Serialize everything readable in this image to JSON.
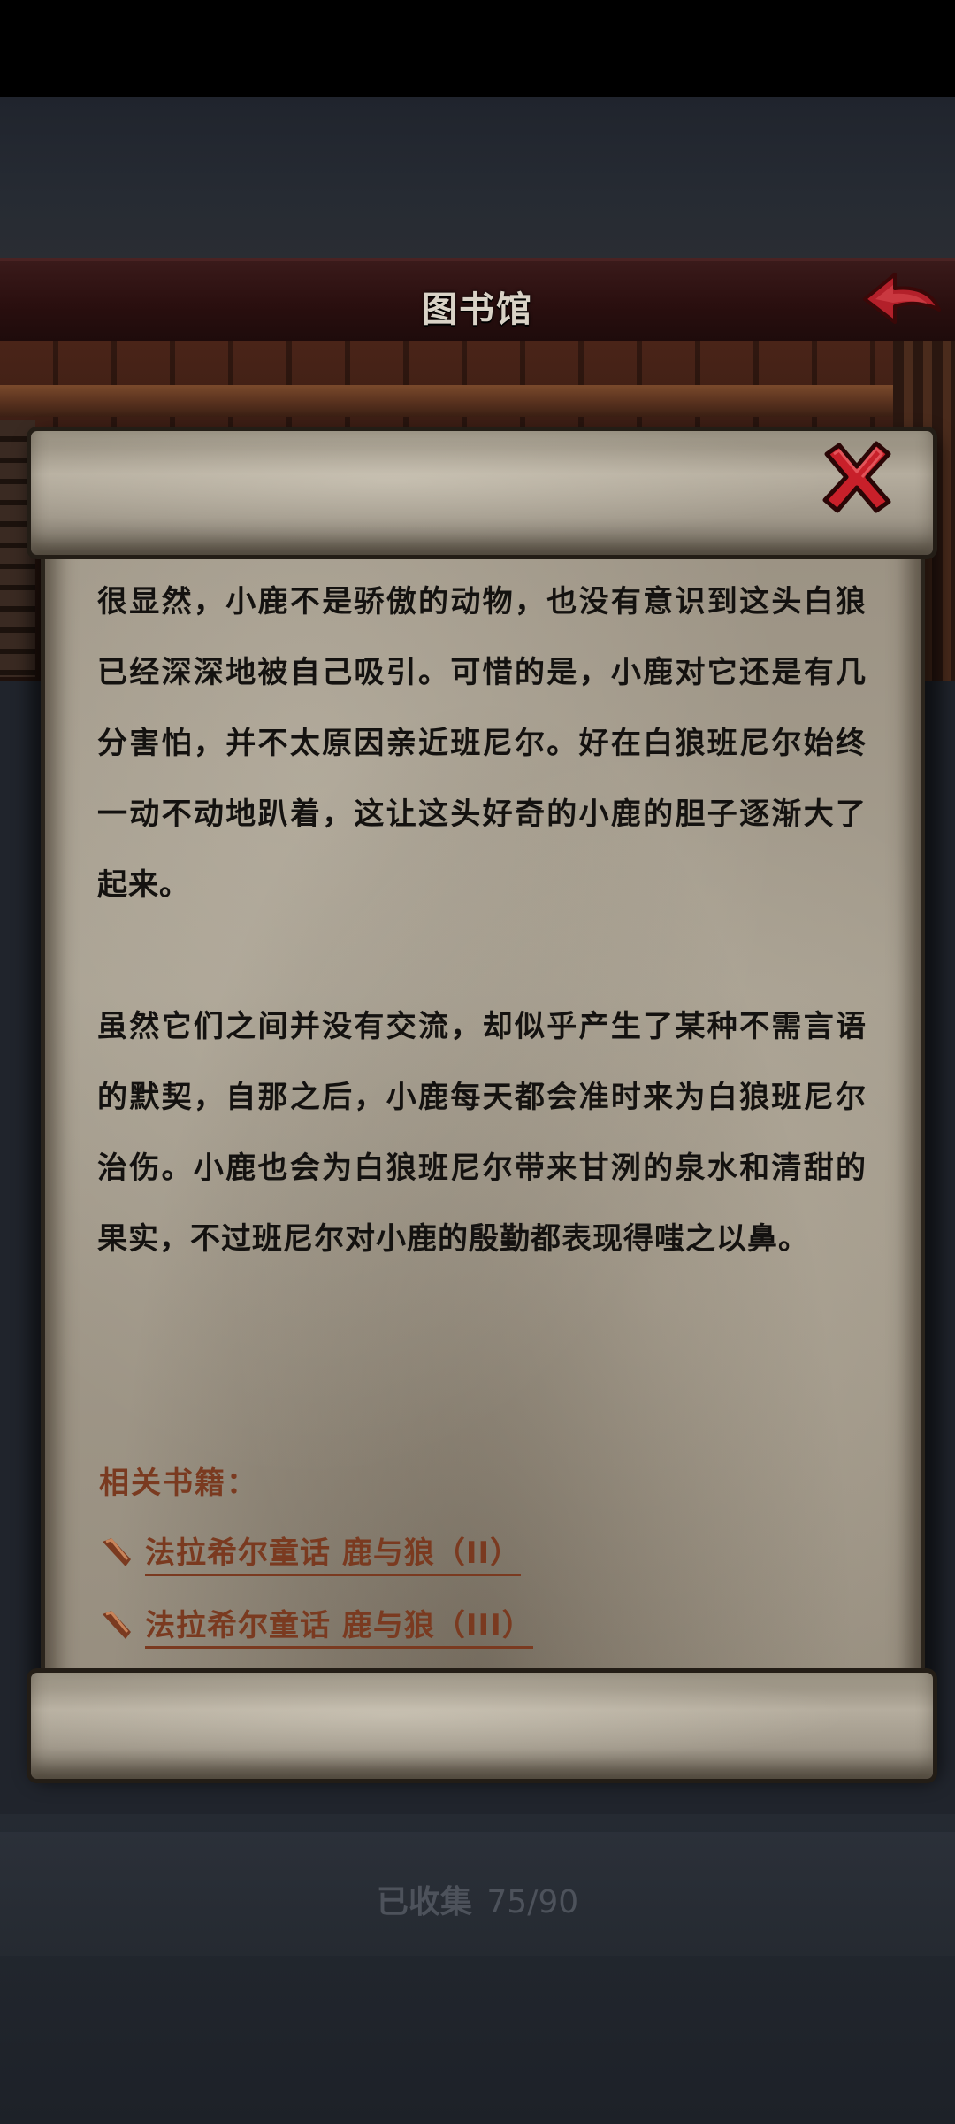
{
  "header": {
    "title": "图书馆"
  },
  "icons": {
    "back": "back-arrow-icon",
    "close": "close-x-icon",
    "link": "quill-icon"
  },
  "content": {
    "paragraphs": [
      "很显然，小鹿不是骄傲的动物，也没有意识到这头白狼已经深深地被自己吸引。可惜的是，小鹿对它还是有几分害怕，并不太原因亲近班尼尔。好在白狼班尼尔始终一动不动地趴着，这让这头好奇的小鹿的胆子逐渐大了起来。",
      "虽然它们之间并没有交流，却似乎产生了某种不需言语的默契，自那之后，小鹿每天都会准时来为白狼班尼尔治伤。小鹿也会为白狼班尼尔带来甘洌的泉水和清甜的果实，不过班尼尔对小鹿的殷勤都表现得嗤之以鼻。"
    ],
    "related_title": "相关书籍：",
    "related_books": [
      "法拉希尔童话 鹿与狼（II）",
      "法拉希尔童话 鹿与狼（III）"
    ]
  },
  "footer": {
    "collected_label": "已收集",
    "collected_count": "75/90"
  },
  "colors": {
    "link": "#7a3a20",
    "title_bar": "#2a0f0f",
    "back_arrow": "#b3202a",
    "close_x": "#c8202a"
  }
}
